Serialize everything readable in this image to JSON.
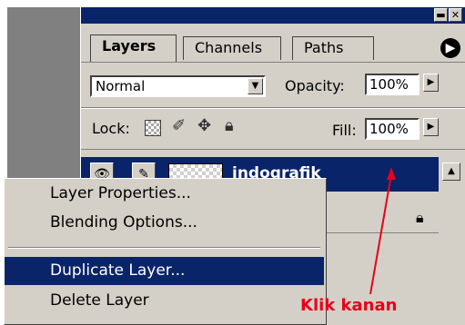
{
  "panel": {
    "tabs": [
      {
        "label": "Layers",
        "active": true
      },
      {
        "label": "Channels",
        "active": false
      },
      {
        "label": "Paths",
        "active": false
      }
    ],
    "blend_mode": "Normal",
    "opacity_label": "Opacity:",
    "opacity_value": "100%",
    "lock_label": "Lock:",
    "fill_label": "Fill:",
    "fill_value": "100%",
    "layer_name": "indografik"
  },
  "context_menu": {
    "items": [
      {
        "label": "Layer Properties..."
      },
      {
        "label": "Blending Options..."
      },
      {
        "label": "Duplicate Layer...",
        "selected": true
      },
      {
        "label": "Delete Layer"
      }
    ]
  },
  "annotation": {
    "text": "Klik kanan",
    "color": "#e8001a"
  },
  "colors": {
    "selection": "#0a246a",
    "face": "#d4d0c8"
  }
}
